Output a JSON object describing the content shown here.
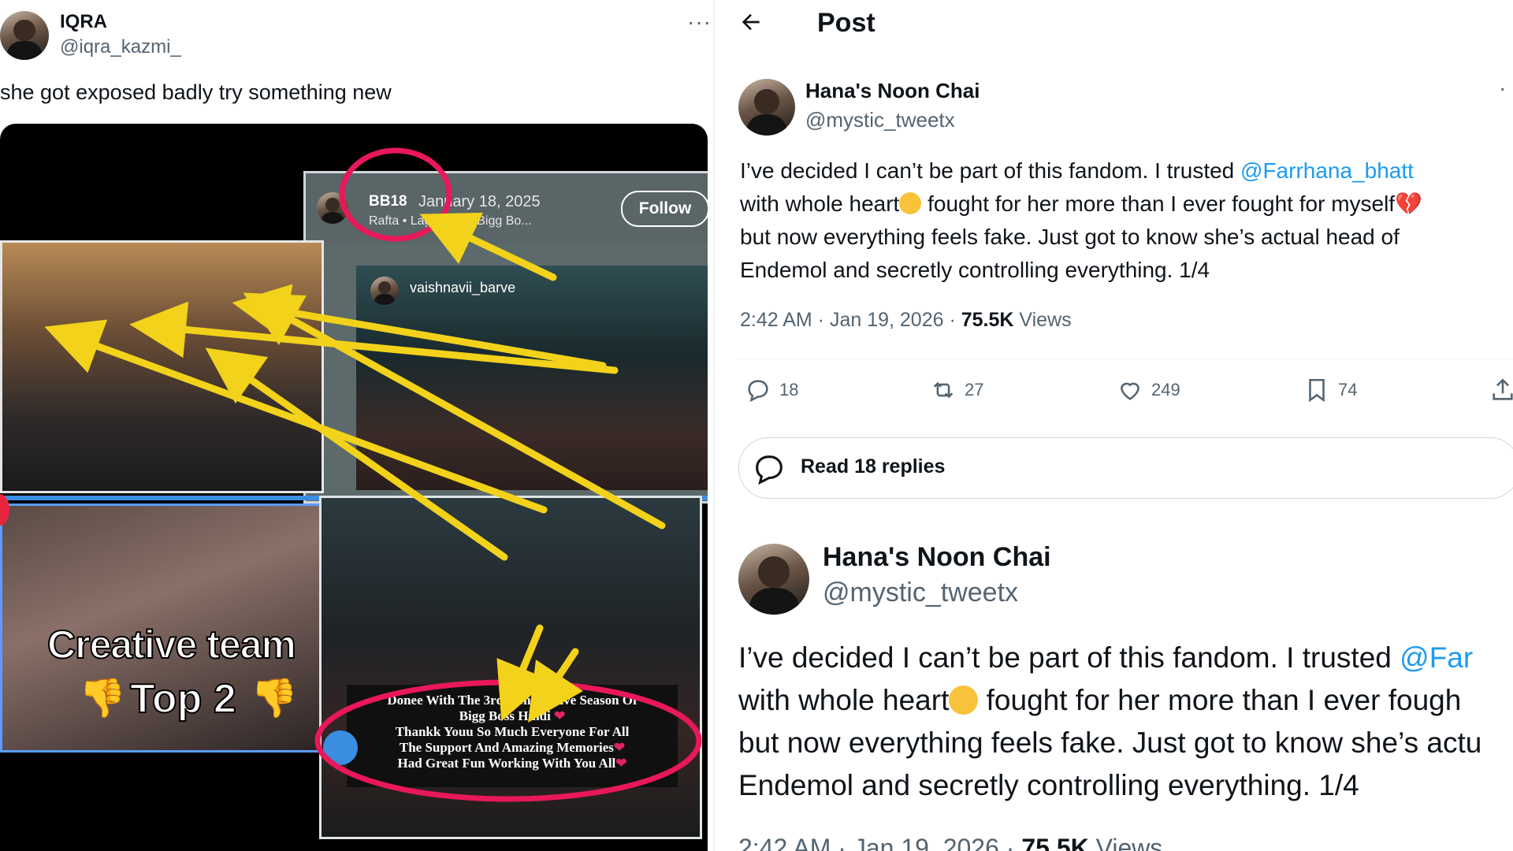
{
  "left_post": {
    "name": "IQRA",
    "handle": "@iqra_kazmi_",
    "more": "···",
    "text": "she got exposed badly try something new",
    "media": {
      "bb_label": "BB18",
      "date": "January 18, 2025",
      "song": "Rafta • Lagi Bachi (Bigg Bo...",
      "follow": "Follow",
      "username": "vaishnavii_barve",
      "overlay_line1": "Creative team",
      "overlay_line2": "Top 2",
      "caption_line1": "Donee With The 3rd Consecutive Season Of",
      "caption_line2": "Bigg Boss Hindi",
      "caption_line3": "Thankk Youu So Much Everyone For All",
      "caption_line4": "The Support And Amazing Memories",
      "caption_line5": "Had Great Fun Working With You All"
    }
  },
  "right_post": {
    "header_title": "Post",
    "name": "Hana's Noon Chai",
    "handle": "@mystic_tweetx",
    "more": "·",
    "body_l1_a": "I’ve decided I can’t be part of this fandom. I trusted ",
    "mention": "@Farrhana_bhatt",
    "body_l2_a": "with whole heart",
    "body_l2_b": " fought for her more than I ever fought for myself",
    "body_l3": "but now everything feels fake. Just got to know she’s actual head of",
    "body_l4": "Endemol and secretly controlling everything. 1/4",
    "time": "2:42 AM · Jan 19, 2026 · ",
    "views_count": "75.5K",
    "views_label": " Views",
    "replies": "18",
    "reposts": "27",
    "likes": "249",
    "bookmarks": "74",
    "read_replies": "Read 18 replies"
  },
  "zoom_post": {
    "name": "Hana's Noon Chai",
    "handle": "@mystic_tweetx",
    "body_l1_a": "I’ve decided I can’t be part of this fandom. I trusted ",
    "mention": "@Far",
    "body_l2_a": "with whole heart",
    "body_l2_b": " fought for her more than I ever fough",
    "body_l3": "but now everything feels fake. Just got to know she’s actu",
    "body_l4": "Endemol and secretly controlling everything. 1/4",
    "meta_partial": "2:42 AM · Jan 19, 2026 · ",
    "views_partial": "75.5K",
    "views_label": " Views"
  },
  "colors": {
    "accent": "#1d9bf0",
    "muted": "#536471",
    "text": "#0f1419",
    "circle": "#e8185a",
    "arrow": "#f2d21a"
  }
}
